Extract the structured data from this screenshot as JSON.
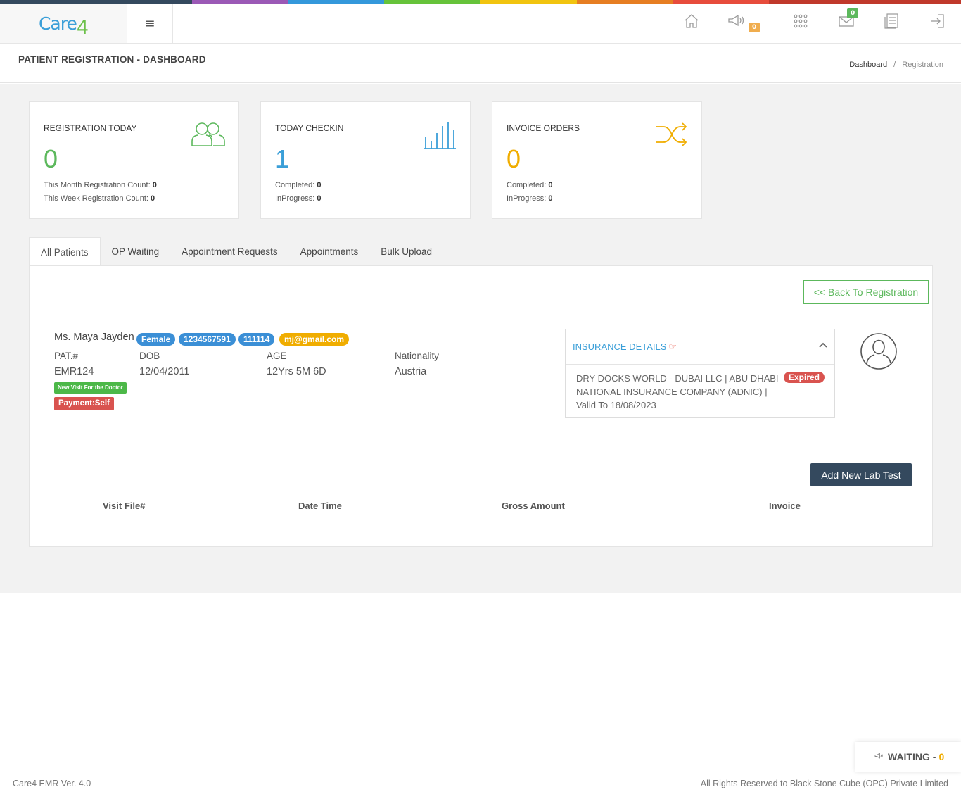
{
  "colors": {
    "top_bar": [
      "#34495e",
      "#9b59b6",
      "#3498db",
      "#66c33a",
      "#f1c40f",
      "#e67e22",
      "#e74c3c",
      "#c0392b"
    ],
    "green": "#5cb85c",
    "blue": "#3b9fd8",
    "orange": "#f0ad00",
    "red": "#d9534f",
    "navy": "#34495e"
  },
  "header": {
    "logo_main": "Care",
    "logo_suffix": "4",
    "menu_icon": "hamburger-icon",
    "icons": [
      "home-icon",
      "megaphone-icon",
      "apps-grid-icon",
      "mail-icon",
      "report-icon",
      "logout-icon"
    ],
    "announcement_count": "0",
    "mail_count": "0"
  },
  "page": {
    "title": "PATIENT REGISTRATION - DASHBOARD",
    "breadcrumb": {
      "home": "Dashboard",
      "sep": "/",
      "current": "Registration"
    }
  },
  "stats": [
    {
      "title": "REGISTRATION TODAY",
      "value": "0",
      "line1_label": "This Month Registration Count:",
      "line1_value": "0",
      "line2_label": "This Week Registration Count:",
      "line2_value": "0",
      "icon": "users-icon"
    },
    {
      "title": "TODAY CHECKIN",
      "value": "1",
      "line1_label": "Completed:",
      "line1_value": "0",
      "line2_label": "InProgress:",
      "line2_value": "0",
      "icon": "bar-chart-icon"
    },
    {
      "title": "INVOICE ORDERS",
      "value": "0",
      "line1_label": "Completed:",
      "line1_value": "0",
      "line2_label": "InProgress:",
      "line2_value": "0",
      "icon": "shuffle-icon"
    }
  ],
  "tabs": [
    "All Patients",
    "OP Waiting",
    "Appointment Requests",
    "Appointments",
    "Bulk Upload"
  ],
  "patient": {
    "back_label": "<< Back To Registration",
    "name": "Ms. Maya Jayden",
    "gender": "Female",
    "phone": "1234567591",
    "code": "111114",
    "email": "mj@gmail.com",
    "labels": {
      "pat": "PAT.#",
      "dob": "DOB",
      "age": "AGE",
      "nationality": "Nationality"
    },
    "values": {
      "pat": "EMR124",
      "dob": "12/04/2011",
      "age": "12Yrs 5M 6D",
      "nationality": "Austria"
    },
    "visit_label": "New Visit For the Doctor",
    "payment_label": "Payment:Self"
  },
  "insurance": {
    "title": "INSURANCE DETAILS",
    "text": "DRY DOCKS WORLD - DUBAI LLC | ABU DHABI NATIONAL INSURANCE COMPANY (ADNIC) | Valid To 18/08/2023",
    "status": "Expired"
  },
  "visits": {
    "add_label": "Add New Lab Test",
    "columns": [
      "Visit File#",
      "Date Time",
      "Gross Amount",
      "Invoice"
    ]
  },
  "waiting": {
    "label": "WAITING -",
    "count": "0"
  },
  "footer": {
    "left": "Care4 EMR Ver. 4.0",
    "right": "All Rights Reserved to Black Stone Cube (OPC) Private Limited"
  }
}
